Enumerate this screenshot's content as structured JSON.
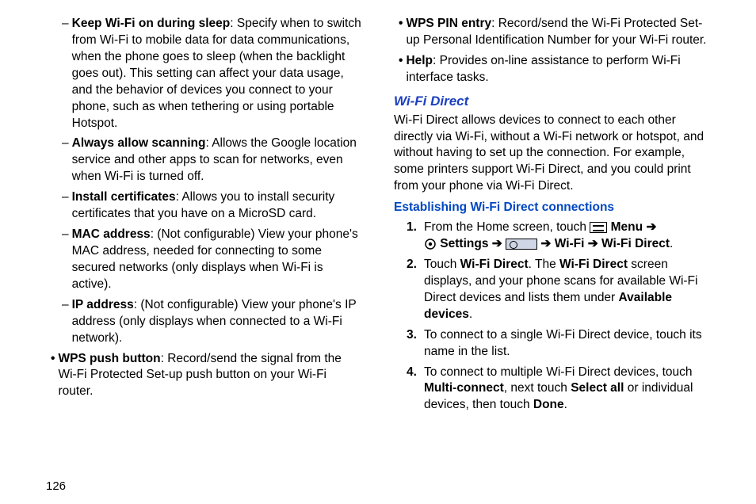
{
  "pageNumber": "126",
  "left": {
    "dashItems": [
      {
        "title": "Keep Wi-Fi on during sleep",
        "text": ": Specify when to switch from Wi-Fi to mobile data for data communications, when the phone goes to sleep (when the backlight goes out). This setting can affect your data usage, and the behavior of devices you connect to your phone, such as when tethering or using portable Hotspot."
      },
      {
        "title": "Always allow scanning",
        "text": ": Allows the Google location service and other apps to scan for networks, even when Wi-Fi is turned off."
      },
      {
        "title": "Install certificates",
        "text": ": Allows you to install security certificates that you have on a MicroSD card."
      },
      {
        "title": "MAC address",
        "text": ": (Not configurable) View your phone's MAC address, needed for connecting to some secured networks (only displays when Wi-Fi is active)."
      },
      {
        "title": "IP address",
        "text": ": (Not configurable) View your phone's IP address (only displays when connected to a Wi-Fi network)."
      }
    ],
    "bullets": [
      {
        "title": "WPS push button",
        "text": ": Record/send the signal from the Wi-Fi Protected Set-up push button on your Wi-Fi router."
      }
    ]
  },
  "right": {
    "topBullets": [
      {
        "title": "WPS PIN entry",
        "text": ": Record/send the Wi-Fi Protected Set-up Personal Identification Number for your Wi-Fi router."
      },
      {
        "title": "Help",
        "text": ": Provides on-line assistance to perform Wi-Fi interface tasks."
      }
    ],
    "heading1": "Wi-Fi Direct",
    "intro": "Wi-Fi Direct allows devices to connect to each other directly via Wi-Fi, without a Wi-Fi network or hotspot, and without having to set up the connection. For example, some printers support Wi-Fi Direct, and you could print from your phone via Wi-Fi Direct.",
    "heading2": "Establishing Wi-Fi Direct connections",
    "steps": {
      "s1_pre": "From the Home screen, touch ",
      "s1_menu": " Menu ",
      "s1_settings": " Settings ",
      "s1_wifi": " Wi-Fi ",
      "s1_wifiDirect": " Wi-Fi Direct",
      "s2_a": "Touch ",
      "s2_b": "Wi-Fi Direct",
      "s2_c": ". The ",
      "s2_d": "Wi-Fi Direct",
      "s2_e": " screen displays, and your phone scans for available Wi-Fi Direct devices and lists them under ",
      "s2_f": "Available devices",
      "s2_g": ".",
      "s3": "To connect to a single Wi-Fi Direct device, touch its name in the list.",
      "s4_a": "To connect to multiple Wi-Fi Direct devices, touch ",
      "s4_b": "Multi-connect",
      "s4_c": ", next touch ",
      "s4_d": "Select all",
      "s4_e": " or individual devices, then touch ",
      "s4_f": "Done",
      "s4_g": "."
    },
    "arrow": "➔",
    "numbers": {
      "n1": "1.",
      "n2": "2.",
      "n3": "3.",
      "n4": "4."
    }
  }
}
